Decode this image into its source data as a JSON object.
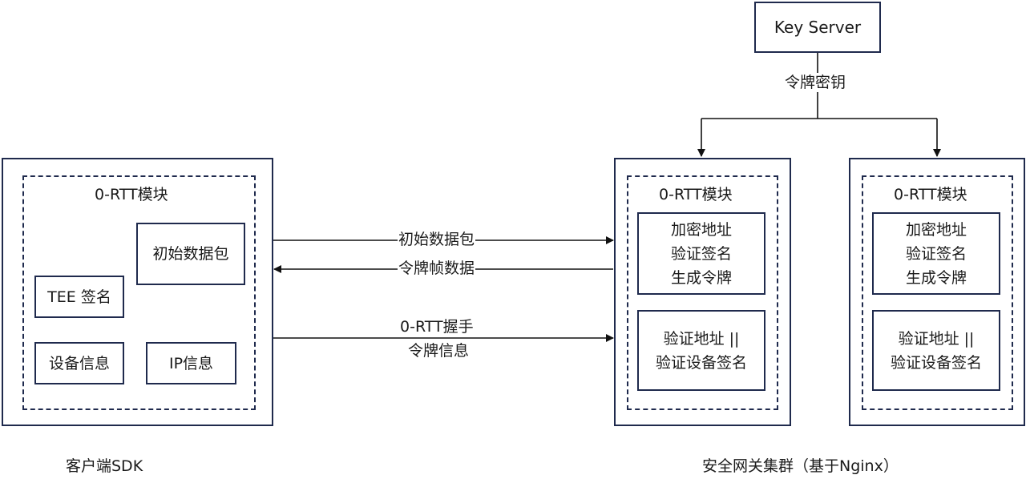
{
  "key_server": {
    "label": "Key Server",
    "edge_label": "令牌密钥"
  },
  "client": {
    "caption": "客户端SDK",
    "module_title": "0-RTT模块",
    "nodes": {
      "initial_packet": "初始数据包",
      "tee_sign": "TEE 签名",
      "device_info": "设备信息",
      "ip_info": "IP信息"
    }
  },
  "gateway": {
    "caption": "安全网关集群（基于Nginx）",
    "nodes": [
      {
        "module_title": "0-RTT模块",
        "block1": [
          "加密地址",
          "验证签名",
          "生成令牌"
        ],
        "block2": [
          "验证地址 ||",
          "验证设备签名"
        ]
      },
      {
        "module_title": "0-RTT模块",
        "block1": [
          "加密地址",
          "验证签名",
          "生成令牌"
        ],
        "block2": [
          "验证地址 ||",
          "验证设备签名"
        ]
      }
    ]
  },
  "edges": {
    "initial_packet": "初始数据包",
    "token_frame": "令牌帧数据",
    "handshake_line1": "0-RTT握手",
    "handshake_line2": "令牌信息"
  },
  "colors": {
    "stroke": "#1f2a4d",
    "arrow": "#111111"
  }
}
